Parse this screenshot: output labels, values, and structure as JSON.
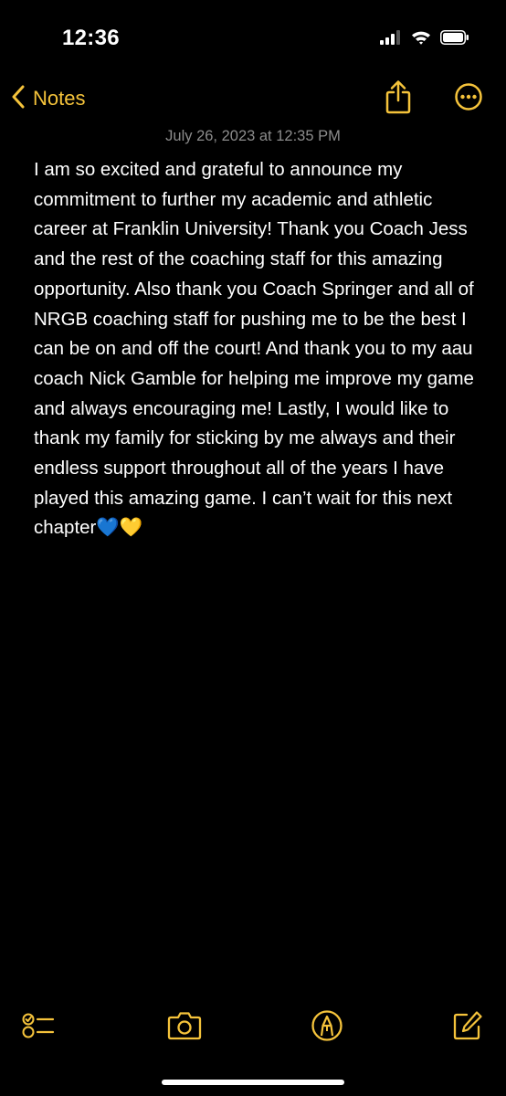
{
  "status_bar": {
    "time": "12:36",
    "icons": [
      "cellular-signal-icon",
      "wifi-icon",
      "battery-icon"
    ]
  },
  "nav": {
    "back_label": "Notes",
    "actions": [
      "share-icon",
      "more-icon"
    ]
  },
  "note": {
    "date": "July 26, 2023 at 12:35 PM",
    "body": "I am so excited and grateful to announce my commitment to further my academic and athletic career at Franklin University! Thank you Coach Jess and the rest of the coaching staff for this amazing opportunity. Also thank you Coach Springer and all of NRGB coaching staff for pushing me to be the best I can be on and off the court! And thank you to my aau coach Nick Gamble for helping me improve my game and always encouraging me! Lastly, I would like to thank my family for sticking by me always and their endless support throughout all of the years I have played this amazing game. I can’t wait for this next chapter💙💛"
  },
  "toolbar": {
    "items": [
      "checklist-icon",
      "camera-icon",
      "markup-pen-icon",
      "compose-icon"
    ]
  },
  "colors": {
    "background": "#000000",
    "accent": "#f5c33b",
    "text": "#ffffff",
    "secondary_text": "#8c8c8c"
  }
}
